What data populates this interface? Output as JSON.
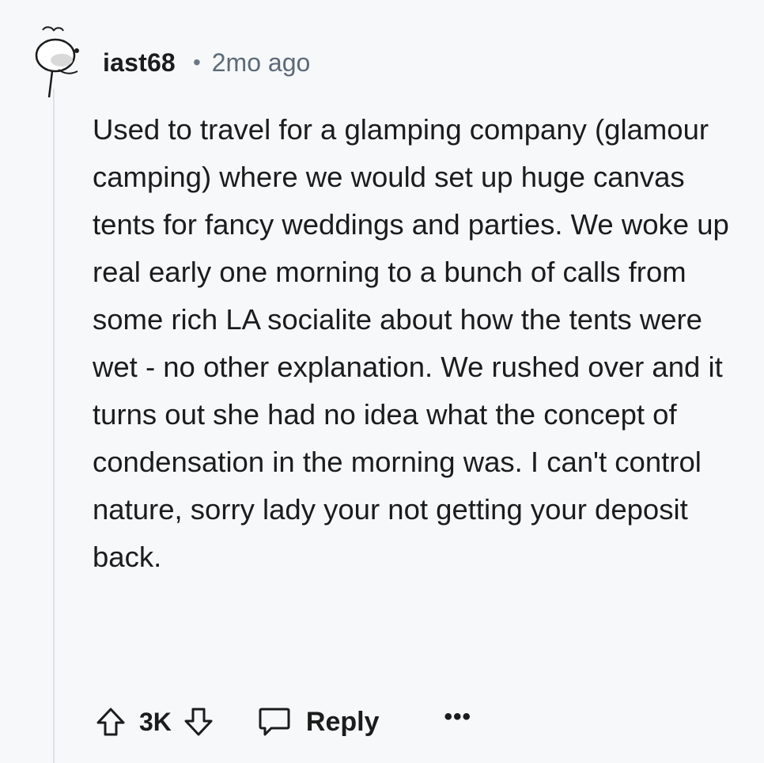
{
  "comment": {
    "username": "iast68",
    "separator": "•",
    "timestamp": "2mo ago",
    "body": "Used to travel for a glamping company (glamour camping) where we would set up huge canvas tents for fancy weddings and parties. We woke up real early one morning to a bunch of calls from some rich LA socialite about how the tents were wet - no other explanation. We rushed over and it turns out she had no idea what the concept of condensation in the morning was. I can't control nature, sorry lady your not getting your deposit back.",
    "avatar_icon": "snoo-avatar-icon"
  },
  "actions": {
    "upvote_icon": "upvote-arrow-icon",
    "score": "3K",
    "downvote_icon": "downvote-arrow-icon",
    "reply_icon": "speech-bubble-icon",
    "reply_label": "Reply",
    "more_label": "•••"
  }
}
